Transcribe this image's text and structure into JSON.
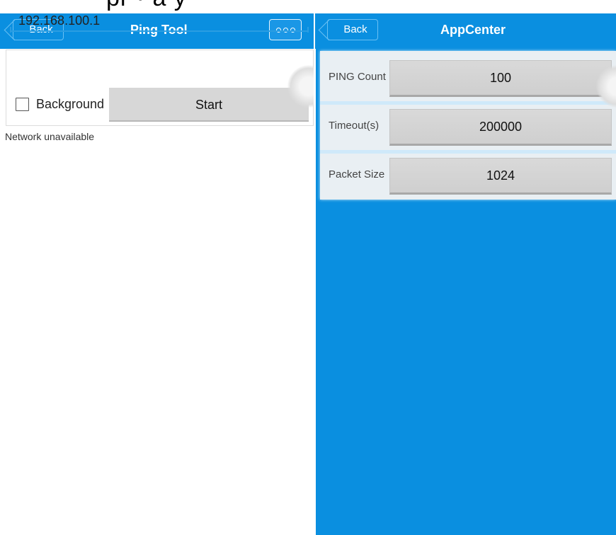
{
  "top_text": "pr        ·   a   y",
  "left": {
    "back_label": "Back",
    "title": "Ping Tool",
    "ip_value": "192.168.100.1",
    "background_label": "Background",
    "start_label": "Start",
    "status": "Network unavailable",
    "more_icon": "more-horizontal-icon"
  },
  "right": {
    "back_label": "Back",
    "title": "AppCenter",
    "rows": [
      {
        "label": "PING Count",
        "value": "100"
      },
      {
        "label": "Timeout(s)",
        "value": "200000"
      },
      {
        "label": "Packet Size",
        "value": "1024"
      }
    ]
  },
  "colors": {
    "accent": "#0a8fe0",
    "field": "#d7d7d7"
  }
}
